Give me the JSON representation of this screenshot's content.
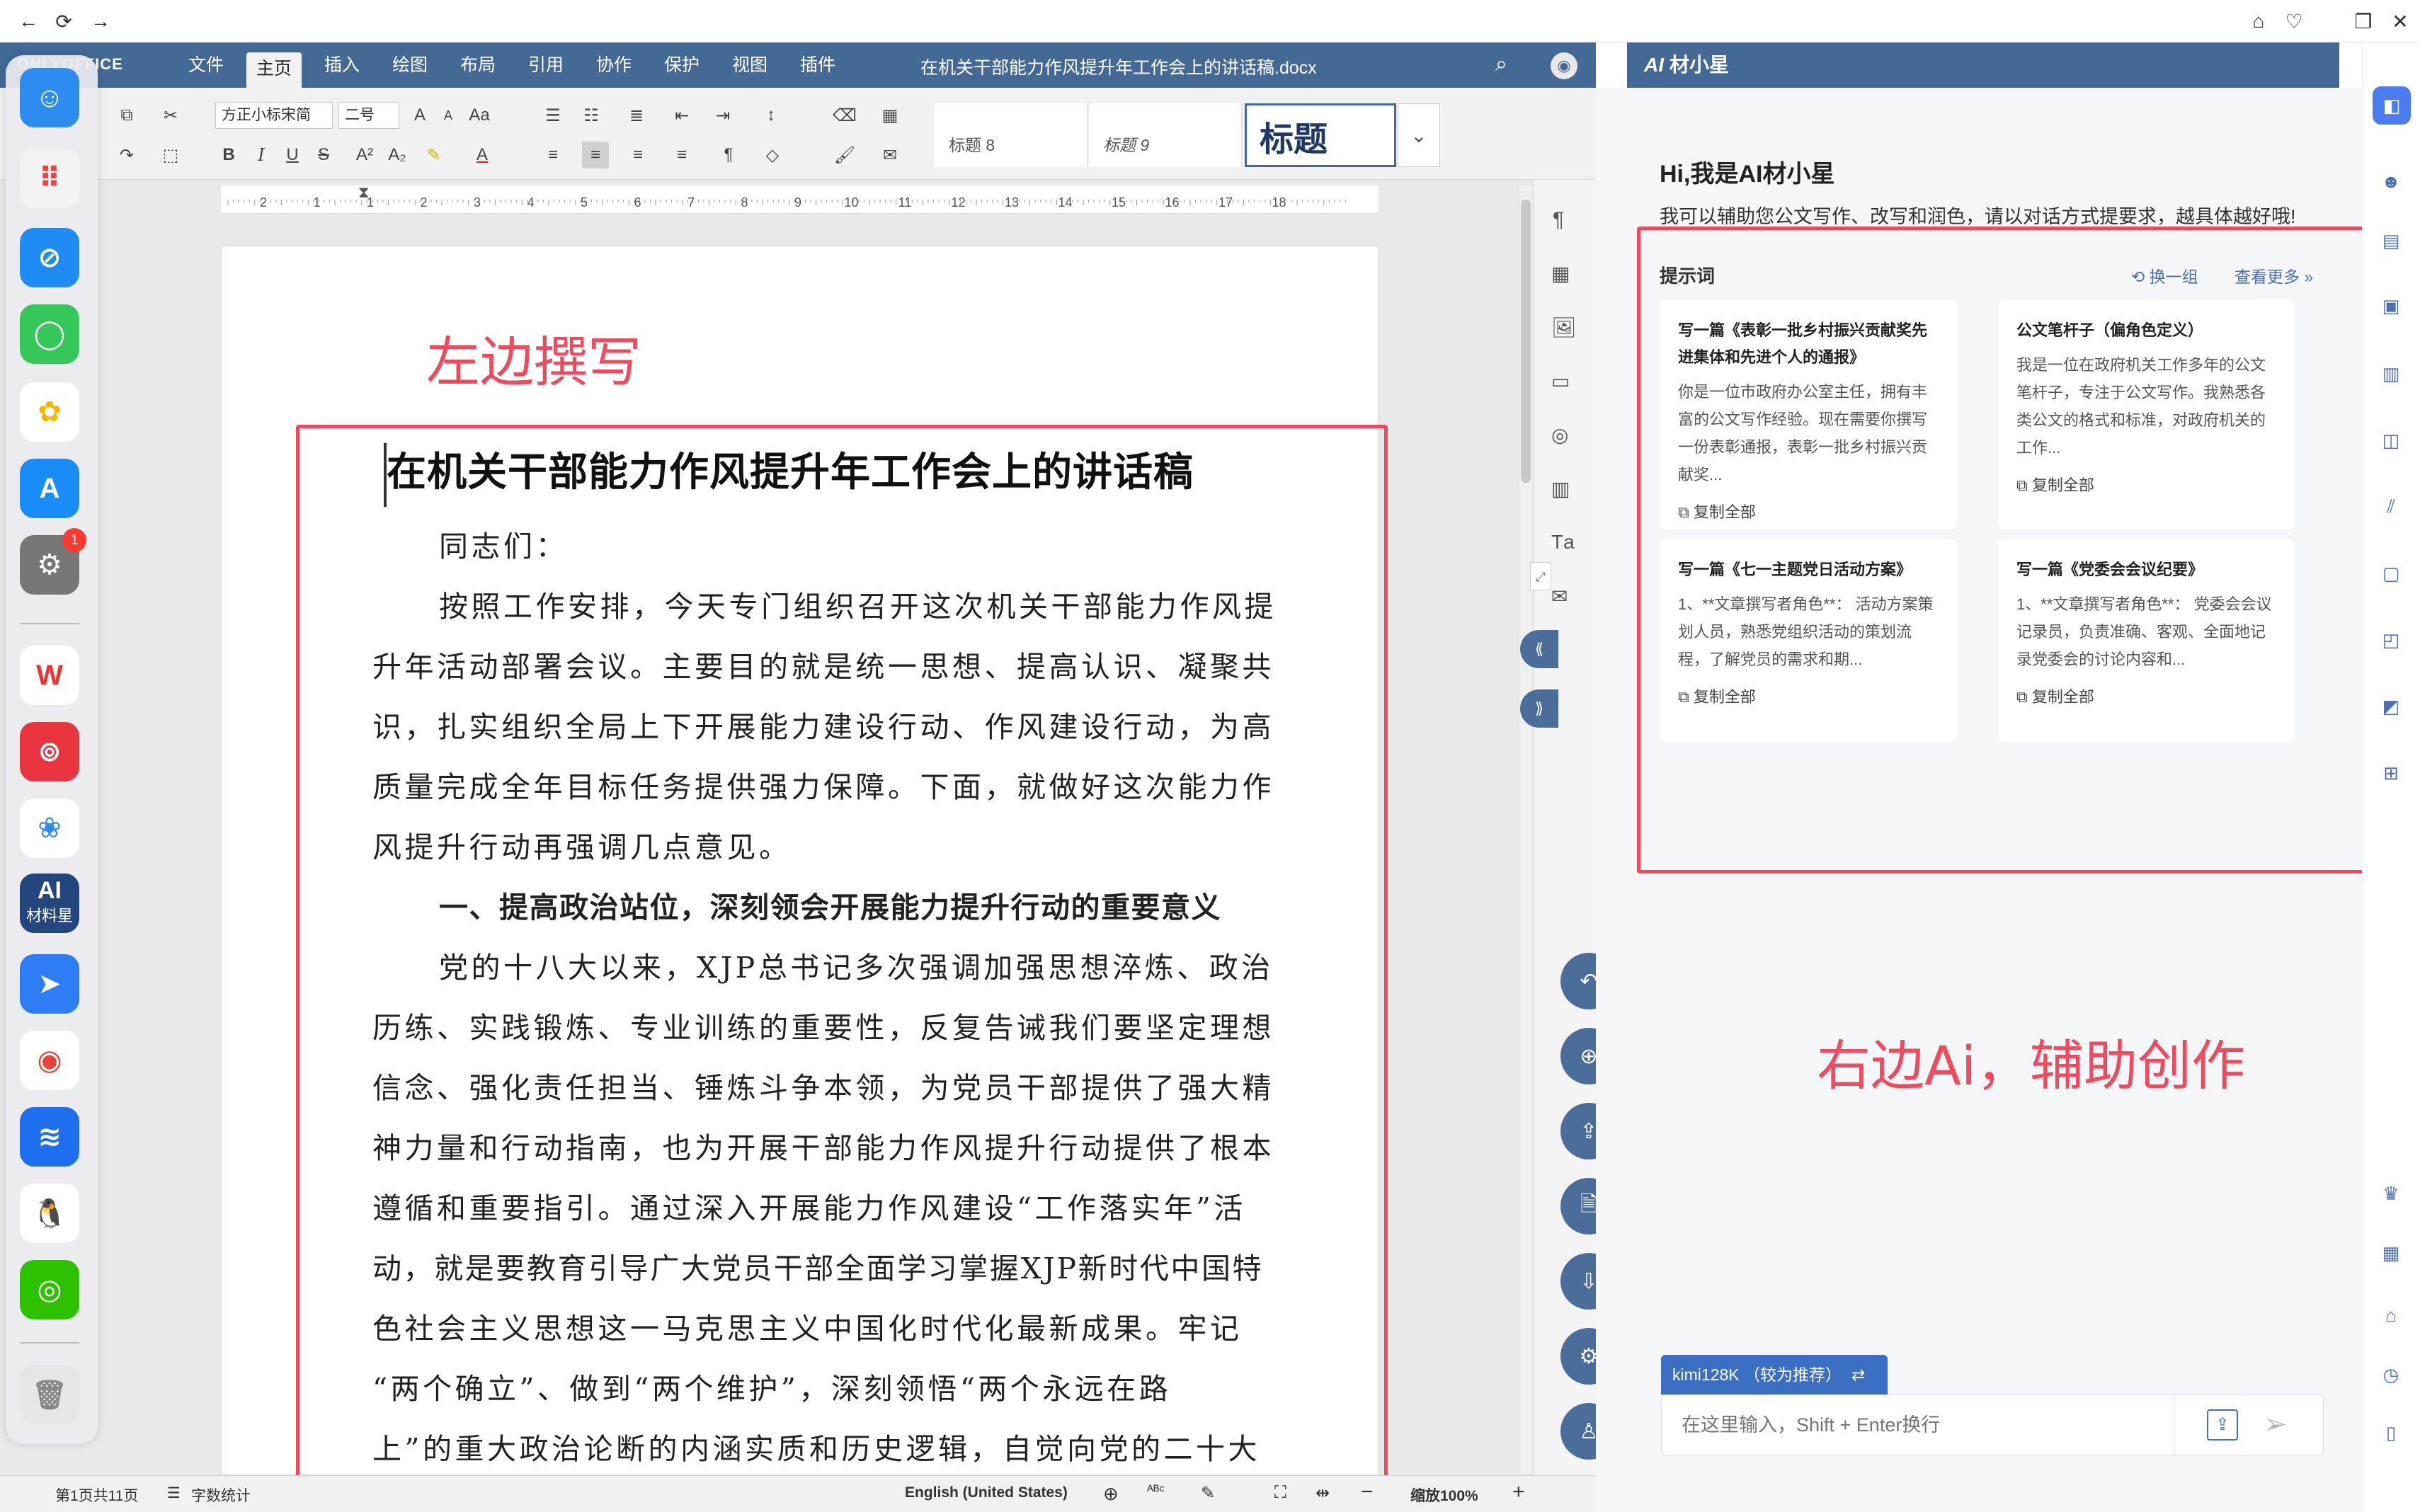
{
  "browser": {
    "nav": [
      "back-icon",
      "refresh-icon",
      "forward-icon"
    ],
    "right": [
      "home-icon",
      "heart-icon",
      "restore-icon",
      "close-icon"
    ]
  },
  "app": {
    "logo": "ONLYOFFICE",
    "menu_tabs": [
      "文件",
      "主页",
      "插入",
      "绘图",
      "布局",
      "引用",
      "协作",
      "保护",
      "视图",
      "插件"
    ],
    "active_tab": "主页",
    "doc_title": "在机关干部能力作风提升年工作会上的讲话稿.docx"
  },
  "toolbar": {
    "font_name": "方正小标宋简",
    "font_size": "二号",
    "styles": [
      "标题 8",
      "标题 9",
      "标题"
    ]
  },
  "ruler_numbers": [
    "2",
    "1",
    "1",
    "2",
    "3",
    "4",
    "5",
    "6",
    "7",
    "8",
    "9",
    "10",
    "11",
    "12",
    "13",
    "14",
    "15",
    "16",
    "17",
    "18"
  ],
  "document": {
    "title": "在机关干部能力作风提升年工作会上的讲话稿",
    "salutation": "同志们：",
    "para1_lines": [
      "按照工作安排，今天专门组织召开这次机关干部能力作风提",
      "升年活动部署会议。主要目的就是统一思想、提高认识、凝聚共",
      "识，扎实组织全局上下开展能力建设行动、作风建设行动，为高",
      "质量完成全年目标任务提供强力保障。下面，就做好这次能力作",
      "风提升行动再强调几点意见。"
    ],
    "heading1": "一、提高政治站位，深刻领会开展能力提升行动的重要意义",
    "para2_lines": [
      "党的十八大以来，XJP总书记多次强调加强思想淬炼、政治",
      "历练、实践锻炼、专业训练的重要性，反复告诫我们要坚定理想",
      "信念、强化责任担当、锤炼斗争本领，为党员干部提供了强大精",
      "神力量和行动指南，也为开展干部能力作风提升行动提供了根本",
      "遵循和重要指引。通过深入开展能力作风建设“工作落实年”活",
      "动，就是要教育引导广大党员干部全面学习掌握XJP新时代中国特",
      "色社会主义思想这一马克思主义中国化时代化最新成果。牢记",
      "“两个确立”、做到“两个维护”，深刻领悟“两个永远在路",
      "上”的重大政治论断的内涵实质和历史逻辑，自觉向党的二十大"
    ]
  },
  "annotations": {
    "left": "左边撰写",
    "right": "右边Ai，辅助创作"
  },
  "status": {
    "page": "第1页共11页",
    "word_count": "字数统计",
    "language": "English (United States)",
    "zoom": "缩放100%"
  },
  "dock": {
    "badge": "1",
    "ai_app_top": "AI",
    "ai_app_bottom": "材料星"
  },
  "ai": {
    "header": "材小星",
    "greeting": "Hi,我是AI材小星",
    "subtitle": "我可以辅助您公文写作、改写和润色，请以对话方式提要求，越具体越好哦!",
    "prompts_label": "提示词",
    "refresh": "换一组",
    "more": "查看更多",
    "copy": "复制全部",
    "cards": [
      {
        "title": "写一篇《表彰一批乡村振兴贡献奖先进集体和先进个人的通报》",
        "text": "你是一位市政府办公室主任，拥有丰富的公文写作经验。现在需要你撰写一份表彰通报，表彰一批乡村振兴贡献奖..."
      },
      {
        "title": "公文笔杆子（偏角色定义）",
        "text": "我是一位在政府机关工作多年的公文笔杆子，专注于公文写作。我熟悉各类公文的格式和标准，对政府机关的工作..."
      },
      {
        "title": "写一篇《七一主题党日活动方案》",
        "text": "1、**文章撰写者角色**： 活动方案策划人员，熟悉党组织活动的策划流程，了解党员的需求和期..."
      },
      {
        "title": "写一篇《党委会会议纪要》",
        "text": "1、**文章撰写者角色**： 党委会会议记录员，负责准确、客观、全面地记录党委会的讨论内容和..."
      }
    ],
    "model": "kimi128K （较为推荐）",
    "input_placeholder": "在这里输入，Shift + Enter换行"
  },
  "colors": {
    "header": "#446995",
    "accent_red": "#f04a5f",
    "fab": "#4a6d99",
    "model_tag": "#3b6fc4"
  }
}
